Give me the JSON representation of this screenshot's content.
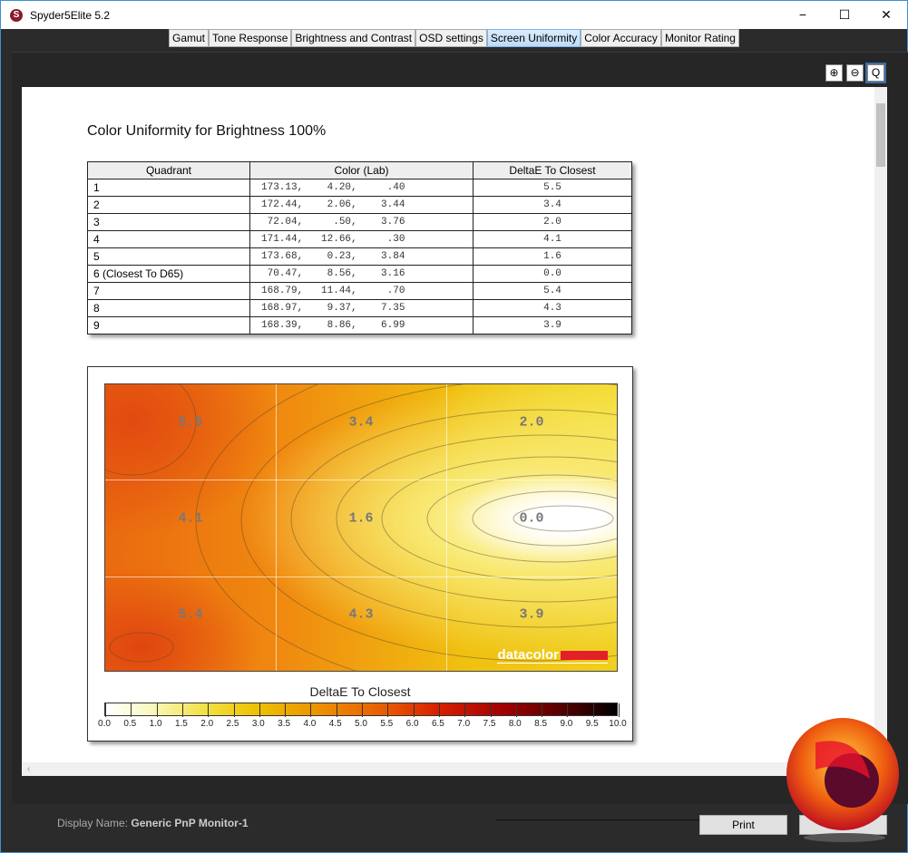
{
  "window": {
    "title": "Spyder5Elite 5.2",
    "minimize": "−",
    "maximize": "☐",
    "close": "✕"
  },
  "tabs": [
    {
      "label": "Gamut"
    },
    {
      "label": "Tone Response"
    },
    {
      "label": "Brightness and Contrast"
    },
    {
      "label": "OSD settings"
    },
    {
      "label": "Screen Uniformity",
      "active": true
    },
    {
      "label": "Color Accuracy"
    },
    {
      "label": "Monitor Rating"
    }
  ],
  "zoom": {
    "in": "⊕",
    "out": "⊖",
    "fit": "Q"
  },
  "report": {
    "title": "Color Uniformity for Brightness 100%",
    "headers": [
      "Quadrant",
      "Color (Lab)",
      "DeltaE To Closest"
    ],
    "rows": [
      [
        "1",
        "173.13,    4.20,     .40",
        "5.5"
      ],
      [
        "2",
        "172.44,    2.06,    3.44",
        "3.4"
      ],
      [
        "3",
        " 72.04,     .50,    3.76",
        "2.0"
      ],
      [
        "4",
        "171.44,   12.66,     .30",
        "4.1"
      ],
      [
        "5",
        "173.68,    0.23,    3.84",
        "1.6"
      ],
      [
        "6 (Closest To D65)",
        " 70.47,    8.56,    3.16",
        "0.0"
      ],
      [
        "7",
        "168.79,   11.44,     .70",
        "5.4"
      ],
      [
        "8",
        "168.97,    9.37,    7.35",
        "4.3"
      ],
      [
        "9",
        "168.39,    8.86,    6.99",
        "3.9"
      ]
    ]
  },
  "heatmap": {
    "quadrant_values": [
      "5.5",
      "3.4",
      "2.0",
      "4.1",
      "1.6",
      "0.0",
      "5.4",
      "4.3",
      "3.9"
    ],
    "logo_text": "datacolor",
    "colorbar_title": "DeltaE To Closest",
    "colorbar_ticks": [
      "0.0",
      "0.5",
      "1.0",
      "1.5",
      "2.0",
      "2.5",
      "3.0",
      "3.5",
      "4.0",
      "4.5",
      "5.0",
      "5.5",
      "6.0",
      "6.5",
      "7.0",
      "7.5",
      "8.0",
      "8.5",
      "9.0",
      "9.5",
      "10.0"
    ]
  },
  "footer": {
    "display_label": "Display Name:",
    "display_name": "Generic PnP Monitor-1",
    "print": "Print"
  }
}
